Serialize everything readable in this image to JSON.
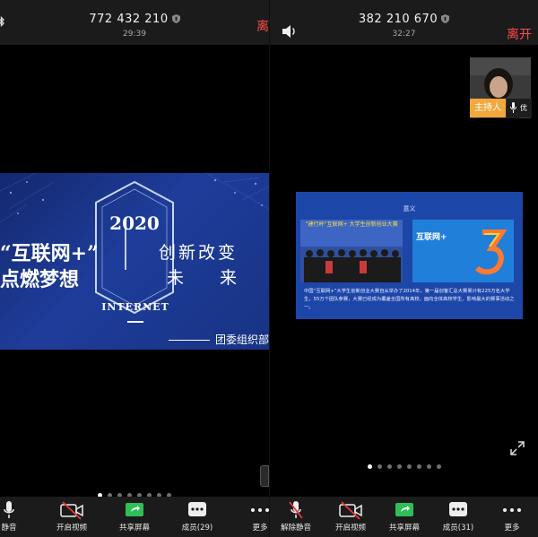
{
  "left": {
    "meeting_id": "772 432 210",
    "timer": "29:39",
    "leave_label": "离",
    "slide": {
      "quote_line": "“互联网+”",
      "title_line": "点燃梦想",
      "year": "2020",
      "slogan_line1": "创新改变",
      "slogan_line2": "未来",
      "internet": "INTERNET",
      "signature": "团委组织部"
    },
    "page_dots": 8,
    "active_dot": 0,
    "toolbar": [
      {
        "name": "mute-button",
        "icon": "microphone-icon",
        "label": "静音"
      },
      {
        "name": "start-video-button",
        "icon": "video-off-icon",
        "label": "开启视频"
      },
      {
        "name": "share-screen-button",
        "icon": "share-screen-icon",
        "label": "共享屏幕"
      },
      {
        "name": "participants-button",
        "icon": "participants-icon",
        "label": "成员(29)"
      },
      {
        "name": "more-button",
        "icon": "more-icon",
        "label": "更多"
      }
    ]
  },
  "right": {
    "meeting_id": "382 210 670",
    "timer": "32:27",
    "leave_label": "离开",
    "host_tag": "主持人",
    "host_mic_label": "优",
    "slide": {
      "title": "意义",
      "photo_banner": "“建行杯”互联网+ 大学生创新创业大赛",
      "brand_text": "互联网+",
      "body": "中国“互联网+”大学生创新创业大赛自从举办了2014年，第一届创客汇总大赛累计有225万名大学生，55万个团队参赛，大赛已经成为覆盖全国所有高校、面向全体高校学生、影响最大的赛事活动之一。"
    },
    "page_dots": 8,
    "active_dot": 0,
    "toolbar": [
      {
        "name": "unmute-button",
        "icon": "microphone-muted-icon",
        "label": "解除静音"
      },
      {
        "name": "start-video-button",
        "icon": "video-off-icon",
        "label": "开启视频"
      },
      {
        "name": "share-screen-button",
        "icon": "share-screen-icon",
        "label": "共享屏幕"
      },
      {
        "name": "participants-button",
        "icon": "participants-icon",
        "label": "成员(31)"
      },
      {
        "name": "more-button",
        "icon": "more-icon",
        "label": "更多"
      }
    ]
  },
  "colors": {
    "leave": "#ff4b4b",
    "host_tag": "#f2a83c",
    "share_green": "#2fbf57",
    "slide_blue": "#1e3d9a"
  }
}
